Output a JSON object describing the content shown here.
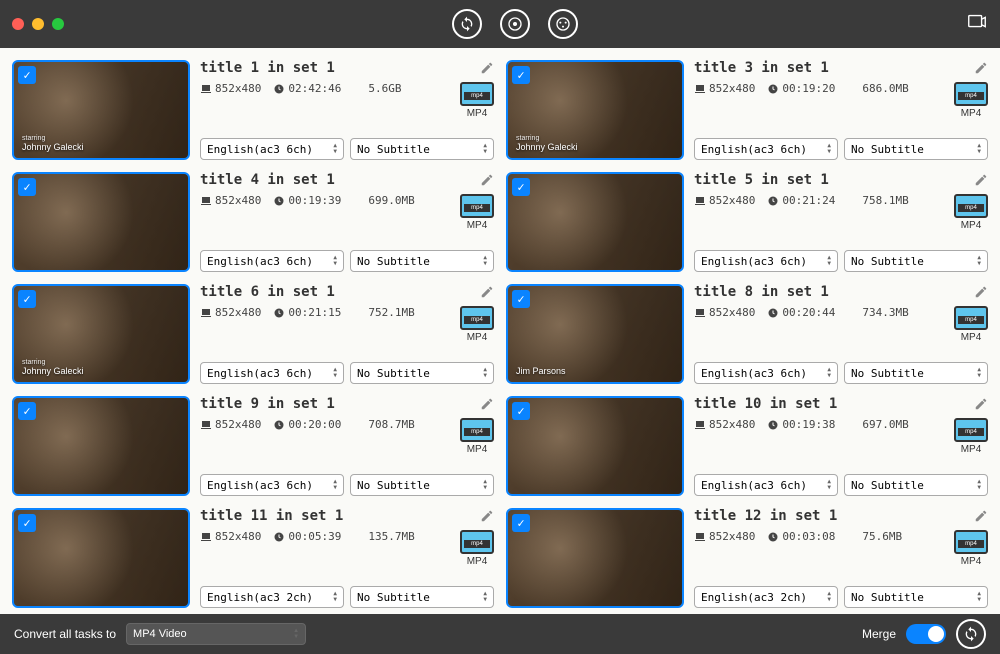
{
  "footer": {
    "convert_label": "Convert all tasks to",
    "convert_format": "MP4 Video",
    "merge_label": "Merge"
  },
  "items": [
    {
      "title": "title 1 in set 1",
      "resolution": "852x480",
      "duration": "02:42:46",
      "size": "5.6GB",
      "format": "MP4",
      "audio": "English(ac3 6ch)",
      "subtitle": "No Subtitle",
      "caption_sub": "starring",
      "caption": "Johnny Galecki"
    },
    {
      "title": "title 3 in set 1",
      "resolution": "852x480",
      "duration": "00:19:20",
      "size": "686.0MB",
      "format": "MP4",
      "audio": "English(ac3 6ch)",
      "subtitle": "No Subtitle",
      "caption_sub": "starring",
      "caption": "Johnny Galecki"
    },
    {
      "title": "title 4 in set 1",
      "resolution": "852x480",
      "duration": "00:19:39",
      "size": "699.0MB",
      "format": "MP4",
      "audio": "English(ac3 6ch)",
      "subtitle": "No Subtitle",
      "caption_sub": "",
      "caption": ""
    },
    {
      "title": "title 5 in set 1",
      "resolution": "852x480",
      "duration": "00:21:24",
      "size": "758.1MB",
      "format": "MP4",
      "audio": "English(ac3 6ch)",
      "subtitle": "No Subtitle",
      "caption_sub": "",
      "caption": ""
    },
    {
      "title": "title 6 in set 1",
      "resolution": "852x480",
      "duration": "00:21:15",
      "size": "752.1MB",
      "format": "MP4",
      "audio": "English(ac3 6ch)",
      "subtitle": "No Subtitle",
      "caption_sub": "starring",
      "caption": "Johnny Galecki"
    },
    {
      "title": "title 8 in set 1",
      "resolution": "852x480",
      "duration": "00:20:44",
      "size": "734.3MB",
      "format": "MP4",
      "audio": "English(ac3 6ch)",
      "subtitle": "No Subtitle",
      "caption_sub": "",
      "caption": "Jim Parsons"
    },
    {
      "title": "title 9 in set 1",
      "resolution": "852x480",
      "duration": "00:20:00",
      "size": "708.7MB",
      "format": "MP4",
      "audio": "English(ac3 6ch)",
      "subtitle": "No Subtitle",
      "caption_sub": "",
      "caption": ""
    },
    {
      "title": "title 10 in set 1",
      "resolution": "852x480",
      "duration": "00:19:38",
      "size": "697.0MB",
      "format": "MP4",
      "audio": "English(ac3 6ch)",
      "subtitle": "No Subtitle",
      "caption_sub": "",
      "caption": ""
    },
    {
      "title": "title 11 in set 1",
      "resolution": "852x480",
      "duration": "00:05:39",
      "size": "135.7MB",
      "format": "MP4",
      "audio": "English(ac3 2ch)",
      "subtitle": "No Subtitle",
      "caption_sub": "",
      "caption": ""
    },
    {
      "title": "title 12 in set 1",
      "resolution": "852x480",
      "duration": "00:03:08",
      "size": "75.6MB",
      "format": "MP4",
      "audio": "English(ac3 2ch)",
      "subtitle": "No Subtitle",
      "caption_sub": "",
      "caption": ""
    }
  ]
}
